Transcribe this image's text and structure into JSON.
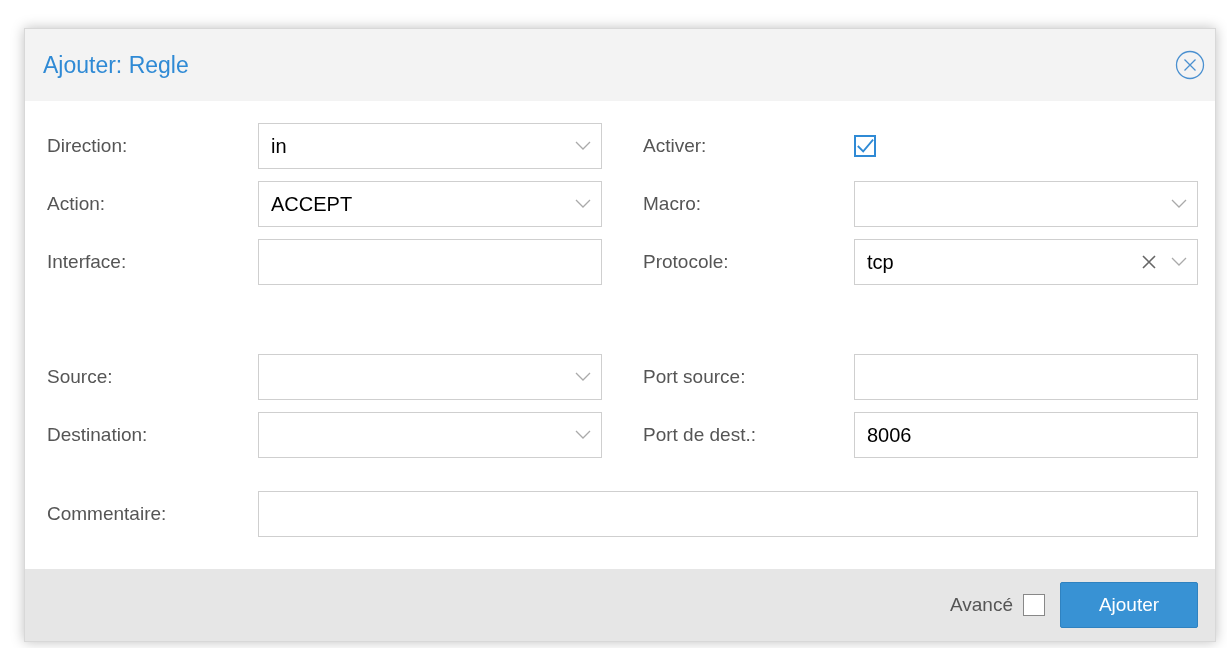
{
  "dialog": {
    "title": "Ajouter: Regle"
  },
  "groups": [
    {
      "kind": "pairs",
      "fields": [
        {
          "label": "Direction:",
          "kind": "select",
          "value": "in"
        },
        {
          "label": "Activer:",
          "kind": "checkbox",
          "checked": true
        },
        {
          "label": "Action:",
          "kind": "select",
          "value": "ACCEPT"
        },
        {
          "label": "Macro:",
          "kind": "select"
        },
        {
          "label": "Interface:",
          "kind": "text"
        },
        {
          "label": "Protocole:",
          "kind": "select",
          "value": "tcp",
          "clearable": true
        }
      ]
    },
    {
      "kind": "pairs",
      "fields": [
        {
          "label": "Source:",
          "kind": "select"
        },
        {
          "label": "Port source:",
          "kind": "text"
        },
        {
          "label": "Destination:",
          "kind": "select"
        },
        {
          "label": "Port de dest.:",
          "kind": "text",
          "value": "8006"
        }
      ]
    },
    {
      "kind": "wide",
      "fields": [
        {
          "label": "Commentaire:",
          "kind": "text"
        }
      ]
    }
  ],
  "footer": {
    "advanced": {
      "label": "Avancé",
      "checked": false
    },
    "submit": "Ajouter"
  }
}
